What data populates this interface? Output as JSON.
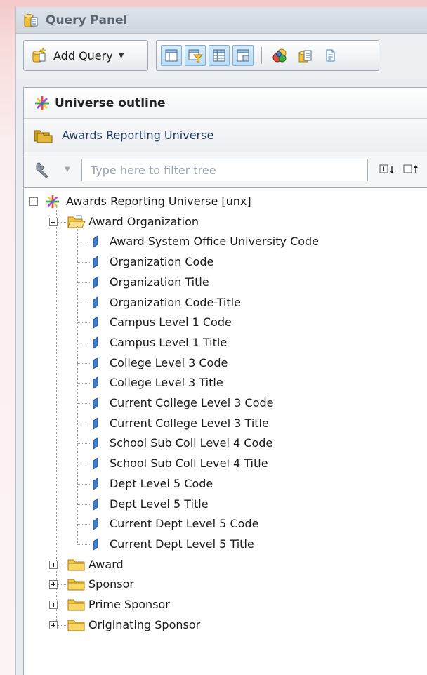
{
  "panel": {
    "title": "Query Panel"
  },
  "toolbar": {
    "add_query_label": "Add Query"
  },
  "outline": {
    "title": "Universe outline",
    "universe_name": "Awards Reporting Universe",
    "filter_placeholder": "Type here to filter tree"
  },
  "tree": {
    "root_label": "Awards Reporting Universe [unx]",
    "folders": [
      {
        "label": "Award Organization",
        "expanded": true,
        "items": [
          "Award System Office University Code",
          "Organization Code",
          "Organization Title",
          "Organization Code-Title",
          "Campus Level 1 Code",
          "Campus Level 1 Title",
          "College Level 3 Code",
          "College Level 3 Title",
          "Current College Level 3 Code",
          "Current College Level 3 Title",
          "School Sub Coll Level 4 Code",
          "School Sub Coll Level 4 Title",
          "Dept Level 5 Code",
          "Dept Level 5 Title",
          "Current Dept Level 5 Code",
          "Current Dept Level 5 Title"
        ]
      },
      {
        "label": "Award",
        "expanded": false,
        "items": []
      },
      {
        "label": "Sponsor",
        "expanded": false,
        "items": []
      },
      {
        "label": "Prime Sponsor",
        "expanded": false,
        "items": []
      },
      {
        "label": "Originating Sponsor",
        "expanded": false,
        "items": []
      }
    ]
  },
  "icons": {
    "panel": "query-panel-icon",
    "add_query": "add-query-icon",
    "outline": "universe-star-icon",
    "universe": "universe-folder-icon",
    "filter_tools": "wrench-icon",
    "dimension": "dimension-icon",
    "folder": "folder-icon"
  },
  "colors": {
    "accent": "#3a7fd0",
    "folder": "#f2c744",
    "toggle_active": "#b8dbf5"
  }
}
